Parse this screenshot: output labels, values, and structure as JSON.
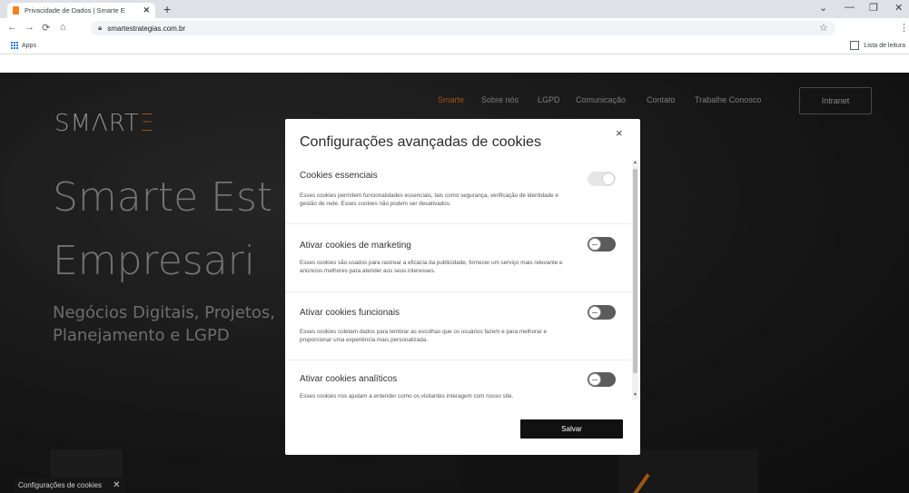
{
  "browser": {
    "tab_title": "Privacidade de Dados | Smarte E",
    "tab_close": "✕",
    "new_tab": "+",
    "window_controls": {
      "dropdown": "⌄",
      "minimize": "—",
      "maximize": "❐",
      "close": "✕"
    },
    "nav": {
      "back": "←",
      "forward": "→",
      "reload": "⟳",
      "home": "⌂"
    },
    "url": "smartestrategias.com.br",
    "star": "☆",
    "menu": "⋮",
    "bookmarks": {
      "apps_label": "Apps",
      "reading_list_label": "Lista de leitura"
    }
  },
  "site": {
    "logo_text": "SMΛRT",
    "logo_accent": "Ξ",
    "nav": [
      "Smarte",
      "Sobre nós",
      "LGPD",
      "Comunicação",
      "Contato",
      "Trabalhe Conosco"
    ],
    "intranet_label": "Intranet",
    "hero_lines": [
      "Smarte Est",
      "Empresari"
    ],
    "hero_sub_lines": [
      "Negócios Digitais, Projetos,",
      "Planejamento e LGPD"
    ],
    "cookie_banner_label": "Configurações de cookies",
    "cookie_banner_close": "✕"
  },
  "modal": {
    "title": "Configurações avançadas de cookies",
    "close": "×",
    "sections": [
      {
        "title": "Cookies essenciais",
        "description": "Esses cookies permitem funcionalidades essenciais, tais como segurança, verificação de identidade e gestão de rede. Esses cookies não podem ser desativados.",
        "enabled": true
      },
      {
        "title": "Ativar cookies de marketing",
        "description": "Esses cookies são usados para rastrear a eficácia da publicidade, fornecer um serviço mais relevante e anúncios melhores para atender aos seus interesses.",
        "enabled": false
      },
      {
        "title": "Ativar cookies funcionais",
        "description": "Esses cookies coletam dados para lembrar as escolhas que os usuários fazem e para melhorar e proporcionar uma experiência mais personalizada.",
        "enabled": false
      },
      {
        "title": "Ativar cookies analíticos",
        "description": "Esses cookies nos ajudam a entender como os visitantes interagem com nosso site.",
        "enabled": false
      }
    ],
    "save_label": "Salvar"
  }
}
